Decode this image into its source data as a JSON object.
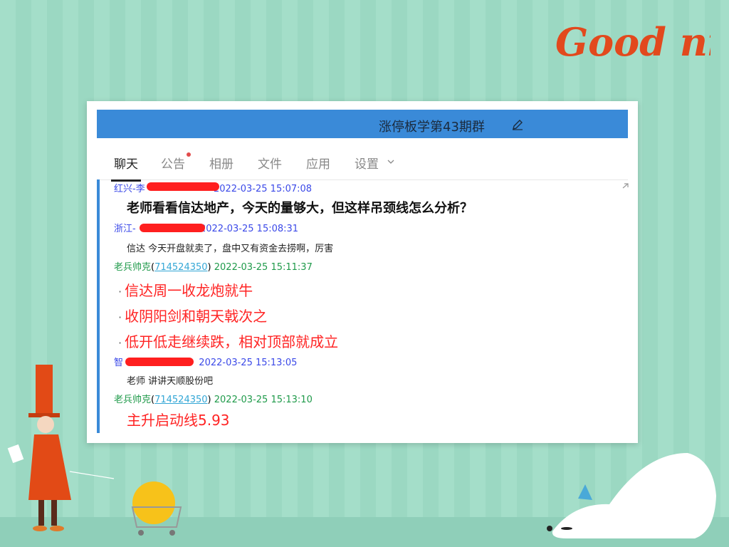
{
  "decor": {
    "greeting": "Good night",
    "greeting_color": "#e2491d"
  },
  "window": {
    "title": "涨停板学第43期群",
    "title_bar_color": "#3a8ad8"
  },
  "tabs": [
    {
      "label": "聊天",
      "active": true
    },
    {
      "label": "公告",
      "has_dot": true
    },
    {
      "label": "相册"
    },
    {
      "label": "文件"
    },
    {
      "label": "应用"
    },
    {
      "label": "设置"
    }
  ],
  "messages": [
    {
      "sender": "红兴-李",
      "time": "2022-03-25 15:07:08",
      "text": "老师看看信达地产，今天的量够大，但这样吊颈线怎么分析？"
    },
    {
      "sender": "浙江-",
      "time": "2022-03-25 15:08:31",
      "text": "信达 今天开盘就卖了，盘中又有资金去捞啊，厉害"
    },
    {
      "sender": "老兵帅克",
      "qq": "714524350",
      "time": "2022-03-25 15:11:37",
      "lines": [
        "信达周一收龙炮就牛",
        "收阴阳剑和朝天戟次之",
        "低开低走继续跌，相对顶部就成立"
      ]
    },
    {
      "sender": "智",
      "time": "2022-03-25 15:13:05",
      "text": "老师 讲讲天顺股份吧"
    },
    {
      "sender": "老兵帅克",
      "qq": "714524350",
      "time": "2022-03-25 15:13:10",
      "text": "主升启动线5.93"
    }
  ]
}
